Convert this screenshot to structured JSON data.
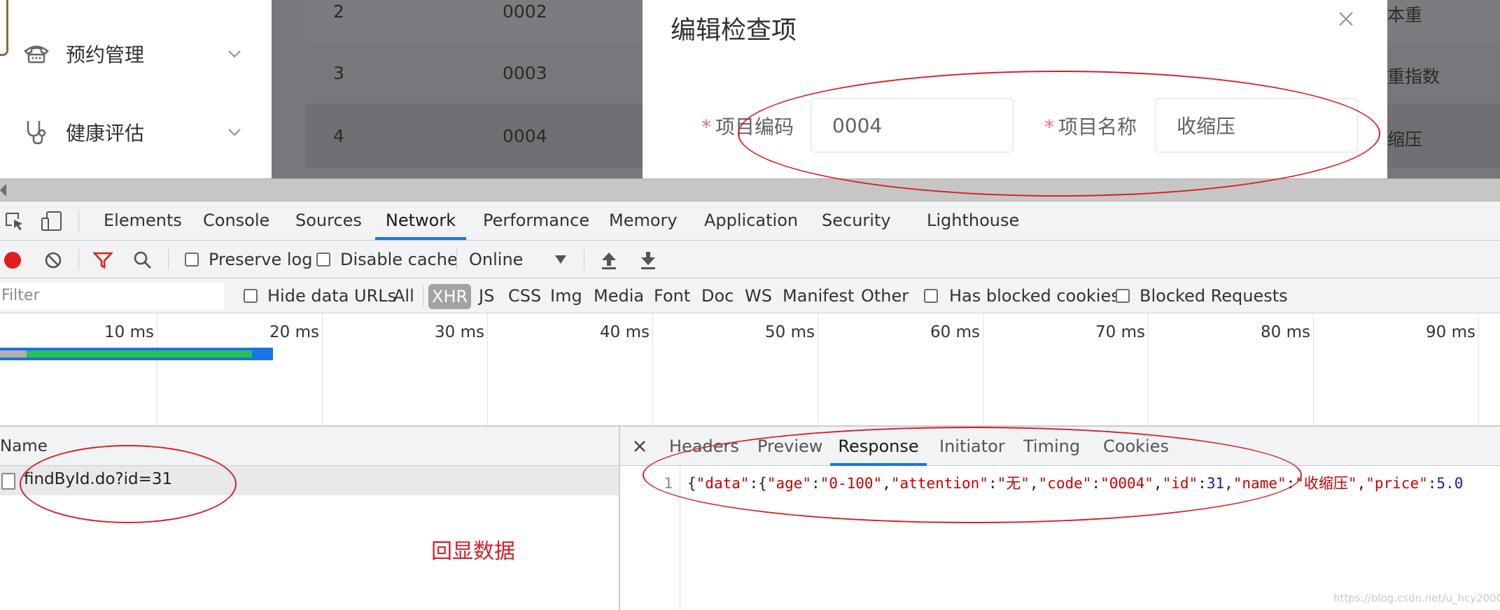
{
  "sidebar": {
    "items": [
      {
        "label": "预约管理",
        "icon": "telephone-icon"
      },
      {
        "label": "健康评估",
        "icon": "stethoscope-icon"
      }
    ]
  },
  "table_bg": {
    "rows": [
      {
        "no": "2",
        "code": "0002",
        "name": "体重"
      },
      {
        "no": "3",
        "code": "0003",
        "name": "体重指数"
      },
      {
        "no": "4",
        "code": "0004",
        "name": "收缩压"
      }
    ],
    "partial_names": [
      "本重",
      "重指数",
      "缩压"
    ]
  },
  "dialog": {
    "title": "编辑检查项",
    "fields": [
      {
        "label": "项目编码",
        "value": "0004"
      },
      {
        "label": "项目名称",
        "value": "收缩压"
      }
    ]
  },
  "devtools": {
    "tabs": [
      "Elements",
      "Console",
      "Sources",
      "Network",
      "Performance",
      "Memory",
      "Application",
      "Security",
      "Lighthouse"
    ],
    "active_tab": "Network",
    "toolbar": {
      "preserve_log": "Preserve log",
      "disable_cache": "Disable cache",
      "throttle": "Online"
    },
    "filter": {
      "placeholder": "Filter",
      "hide_data_urls": "Hide data URLs",
      "types": [
        "All",
        "XHR",
        "JS",
        "CSS",
        "Img",
        "Media",
        "Font",
        "Doc",
        "WS",
        "Manifest",
        "Other"
      ],
      "active_type": "XHR",
      "has_blocked_cookies": "Has blocked cookies",
      "blocked_requests": "Blocked Requests"
    },
    "timeline_ticks": [
      "10 ms",
      "20 ms",
      "30 ms",
      "40 ms",
      "50 ms",
      "60 ms",
      "70 ms",
      "80 ms",
      "90 ms"
    ],
    "name_column": "Name",
    "requests": [
      "findById.do?id=31"
    ],
    "detail_tabs": [
      "Headers",
      "Preview",
      "Response",
      "Initiator",
      "Timing",
      "Cookies"
    ],
    "active_detail_tab": "Response",
    "response": {
      "line_no": "1",
      "tokens": [
        {
          "t": "{",
          "c": "p"
        },
        {
          "t": "\"data\"",
          "c": "k"
        },
        {
          "t": ":{",
          "c": "p"
        },
        {
          "t": "\"age\"",
          "c": "k"
        },
        {
          "t": ":",
          "c": "p"
        },
        {
          "t": "\"0-100\"",
          "c": "s"
        },
        {
          "t": ",",
          "c": "p"
        },
        {
          "t": "\"attention\"",
          "c": "k"
        },
        {
          "t": ":",
          "c": "p"
        },
        {
          "t": "\"无\"",
          "c": "s"
        },
        {
          "t": ",",
          "c": "p"
        },
        {
          "t": "\"code\"",
          "c": "k"
        },
        {
          "t": ":",
          "c": "p"
        },
        {
          "t": "\"0004\"",
          "c": "s"
        },
        {
          "t": ",",
          "c": "p"
        },
        {
          "t": "\"id\"",
          "c": "k"
        },
        {
          "t": ":",
          "c": "p"
        },
        {
          "t": "31",
          "c": "n"
        },
        {
          "t": ",",
          "c": "p"
        },
        {
          "t": "\"name\"",
          "c": "k"
        },
        {
          "t": ":",
          "c": "p"
        },
        {
          "t": "\"收缩压\"",
          "c": "s"
        },
        {
          "t": ",",
          "c": "p"
        },
        {
          "t": "\"price\"",
          "c": "k"
        },
        {
          "t": ":",
          "c": "p"
        },
        {
          "t": "5.0",
          "c": "n"
        }
      ]
    }
  },
  "annotation": "回显数据",
  "watermark": "https://blog.csdn.net/u_hcy2000",
  "colors": {
    "annotation_red": "#d81e2a",
    "devtools_blue": "#1a73e8",
    "required_star": "#f56c6c"
  }
}
